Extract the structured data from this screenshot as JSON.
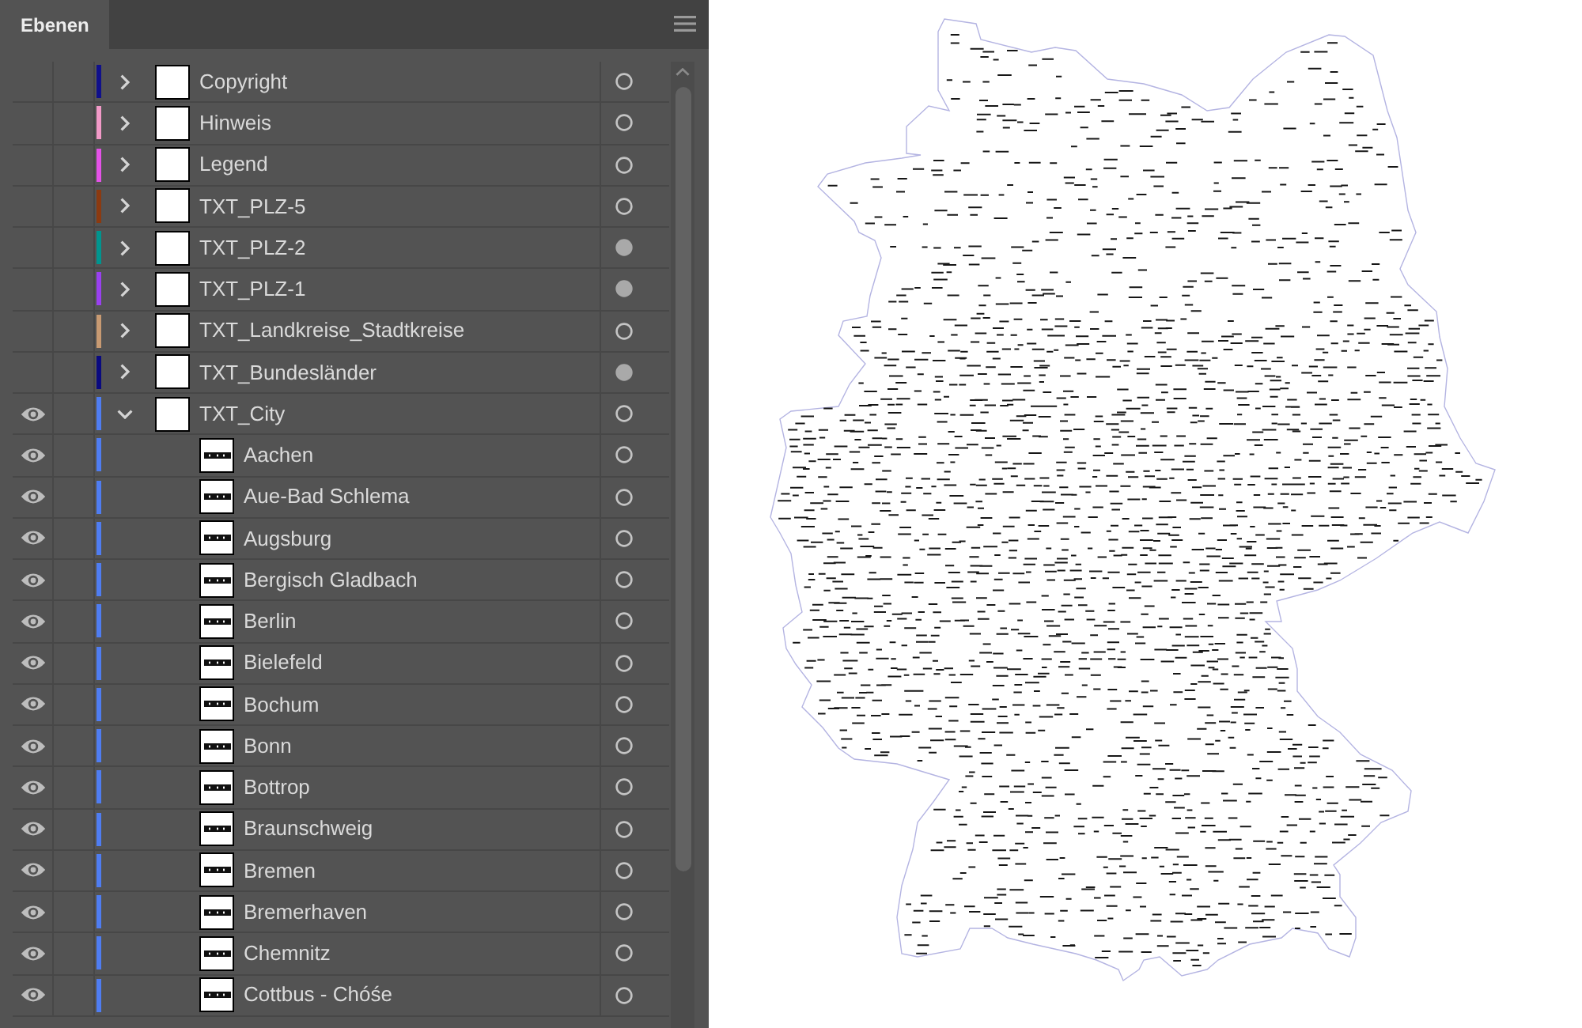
{
  "panel": {
    "tabs": [
      {
        "label": "Ebenen",
        "selected": true
      }
    ],
    "layers": [
      {
        "name": "Copyright",
        "color": "#10108c",
        "visible": false,
        "expanded": false,
        "target_filled": false
      },
      {
        "name": "Hinweis",
        "color": "#f29ac8",
        "visible": false,
        "expanded": false,
        "target_filled": false
      },
      {
        "name": "Legend",
        "color": "#e452e8",
        "visible": false,
        "expanded": false,
        "target_filled": false
      },
      {
        "name": "TXT_PLZ-5",
        "color": "#8c3a10",
        "visible": false,
        "expanded": false,
        "target_filled": false
      },
      {
        "name": "TXT_PLZ-2",
        "color": "#00958f",
        "visible": false,
        "expanded": false,
        "target_filled": true
      },
      {
        "name": "TXT_PLZ-1",
        "color": "#9a40f0",
        "visible": false,
        "expanded": false,
        "target_filled": true
      },
      {
        "name": "TXT_Landkreise_Stadtkreise",
        "color": "#c89a72",
        "visible": false,
        "expanded": false,
        "target_filled": false
      },
      {
        "name": "TXT_Bundesländer",
        "color": "#0a0a80",
        "visible": false,
        "expanded": false,
        "target_filled": true
      },
      {
        "name": "TXT_City",
        "color": "#4f7df2",
        "visible": true,
        "expanded": true,
        "target_filled": false,
        "children": [
          {
            "name": "Aachen",
            "visible": true,
            "target_filled": false
          },
          {
            "name": "Aue-Bad Schlema",
            "visible": true,
            "target_filled": false
          },
          {
            "name": "Augsburg",
            "visible": true,
            "target_filled": false
          },
          {
            "name": "Bergisch Gladbach",
            "visible": true,
            "target_filled": false
          },
          {
            "name": "Berlin",
            "visible": true,
            "target_filled": false
          },
          {
            "name": "Bielefeld",
            "visible": true,
            "target_filled": false
          },
          {
            "name": "Bochum",
            "visible": true,
            "target_filled": false
          },
          {
            "name": "Bonn",
            "visible": true,
            "target_filled": false
          },
          {
            "name": "Bottrop",
            "visible": true,
            "target_filled": false
          },
          {
            "name": "Braunschweig",
            "visible": true,
            "target_filled": false
          },
          {
            "name": "Bremen",
            "visible": true,
            "target_filled": false
          },
          {
            "name": "Bremerhaven",
            "visible": true,
            "target_filled": false
          },
          {
            "name": "Chemnitz",
            "visible": true,
            "target_filled": false
          },
          {
            "name": "Cottbus - Chóśe",
            "visible": true,
            "target_filled": false
          }
        ]
      }
    ]
  }
}
